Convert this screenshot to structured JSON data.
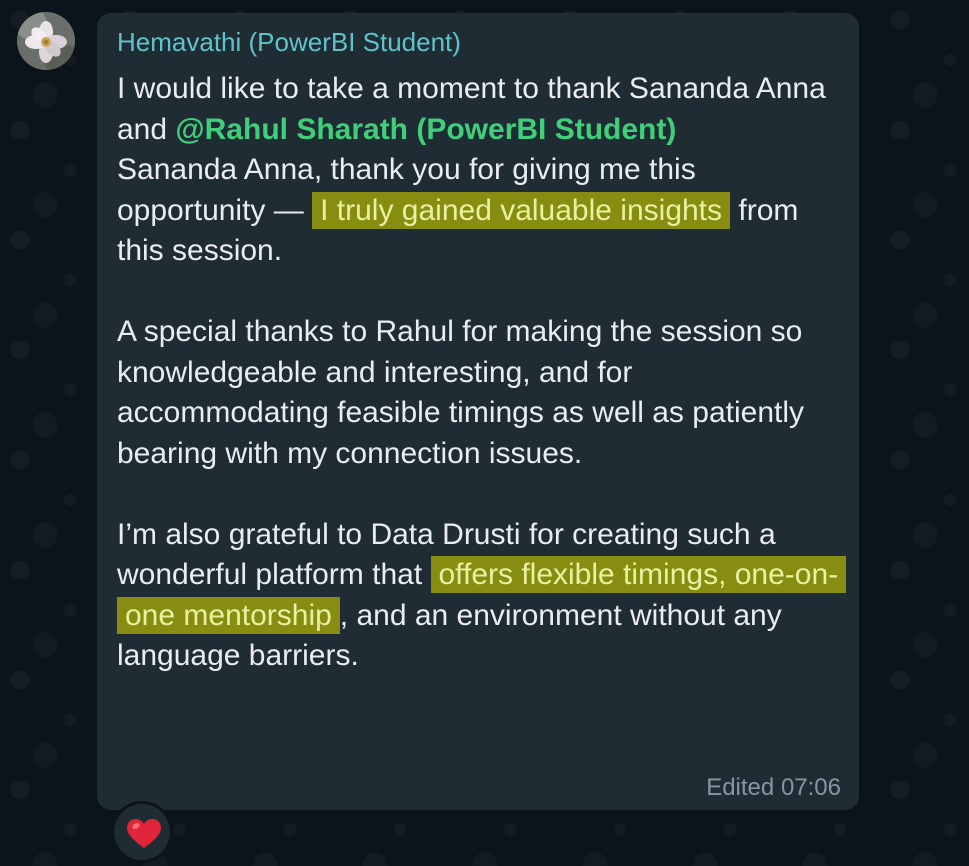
{
  "message": {
    "sender": "Hemavathi (PowerBI Student)",
    "paragraphs": {
      "p1_a": "I would like to take a moment to thank Sananda Anna and ",
      "p1_mention": "@Rahul Sharath (PowerBI Student)",
      "p2_a": "Sananda Anna, thank you for giving me this opportunity — ",
      "p2_highlight": "I truly gained valuable insights",
      "p2_b": " from this session.",
      "p3": "A special thanks to Rahul for making the session so knowledgeable and interesting, and for accommodating feasible timings as well as patiently bearing with my connection issues.",
      "p4_a": "I’m also grateful to Data Drusti for creating such a wonderful platform that ",
      "p4_highlight": "offers flexible timings, one-on-one mentorship",
      "p4_b": ", and an environment without any language barriers."
    },
    "edited_label": "Edited",
    "time": "07:06"
  },
  "reaction": {
    "emoji": "heart-icon",
    "color": "#e0243a"
  },
  "colors": {
    "background": "#0b141a",
    "bubble": "#202c33",
    "sender": "#5ec4c9",
    "mention": "#3fcf7a",
    "highlight": "#878d10",
    "text": "#e9edef",
    "meta": "#8696a0"
  }
}
